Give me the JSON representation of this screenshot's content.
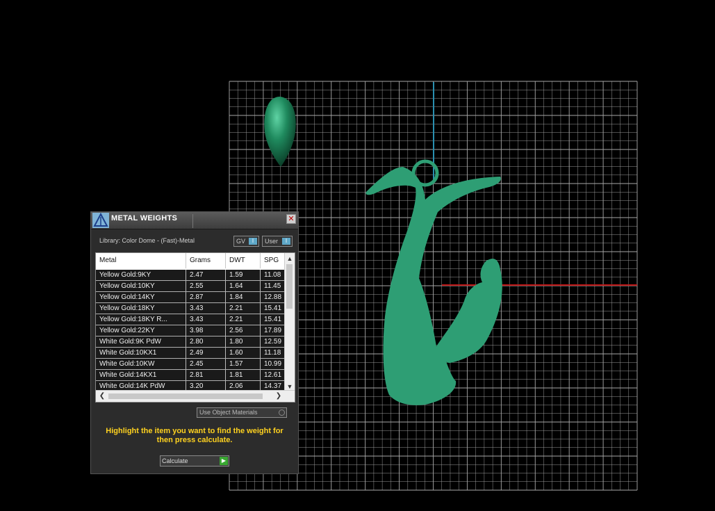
{
  "dialog": {
    "title": "METAL WEIGHTS",
    "library_label": "Library: Color Dome - (Fast)-Metal",
    "gv_label": "GV",
    "user_label": "User",
    "columns": [
      "Metal",
      "Grams",
      "DWT",
      "SPG"
    ],
    "rows": [
      [
        "Yellow Gold:9KY",
        "2.47",
        "1.59",
        "11.08"
      ],
      [
        "Yellow Gold:10KY",
        "2.55",
        "1.64",
        "11.45"
      ],
      [
        "Yellow Gold:14KY",
        "2.87",
        "1.84",
        "12.88"
      ],
      [
        "Yellow Gold:18KY",
        "3.43",
        "2.21",
        "15.41"
      ],
      [
        "Yellow Gold:18KY R...",
        "3.43",
        "2.21",
        "15.41"
      ],
      [
        "Yellow Gold:22KY",
        "3.98",
        "2.56",
        "17.89"
      ],
      [
        "White Gold:9K PdW",
        "2.80",
        "1.80",
        "12.59"
      ],
      [
        "White Gold:10KX1",
        "2.49",
        "1.60",
        "11.18"
      ],
      [
        "White Gold:10KW",
        "2.45",
        "1.57",
        "10.99"
      ],
      [
        "White Gold:14KX1",
        "2.81",
        "1.81",
        "12.61"
      ],
      [
        "White Gold:14K PdW",
        "3.20",
        "2.06",
        "14.37"
      ]
    ],
    "use_object_materials_label": "Use Object Materials",
    "hint": "Highlight the item you want to find the weight for then press calculate.",
    "calculate_label": "Calculate"
  },
  "colors": {
    "model": "#2e9e74",
    "dome": "#1f7a55",
    "grid": "#a8a8a8",
    "axis_y": "#2a8fb0",
    "axis_x": "#c01818",
    "hint_text": "#ffd21f"
  }
}
